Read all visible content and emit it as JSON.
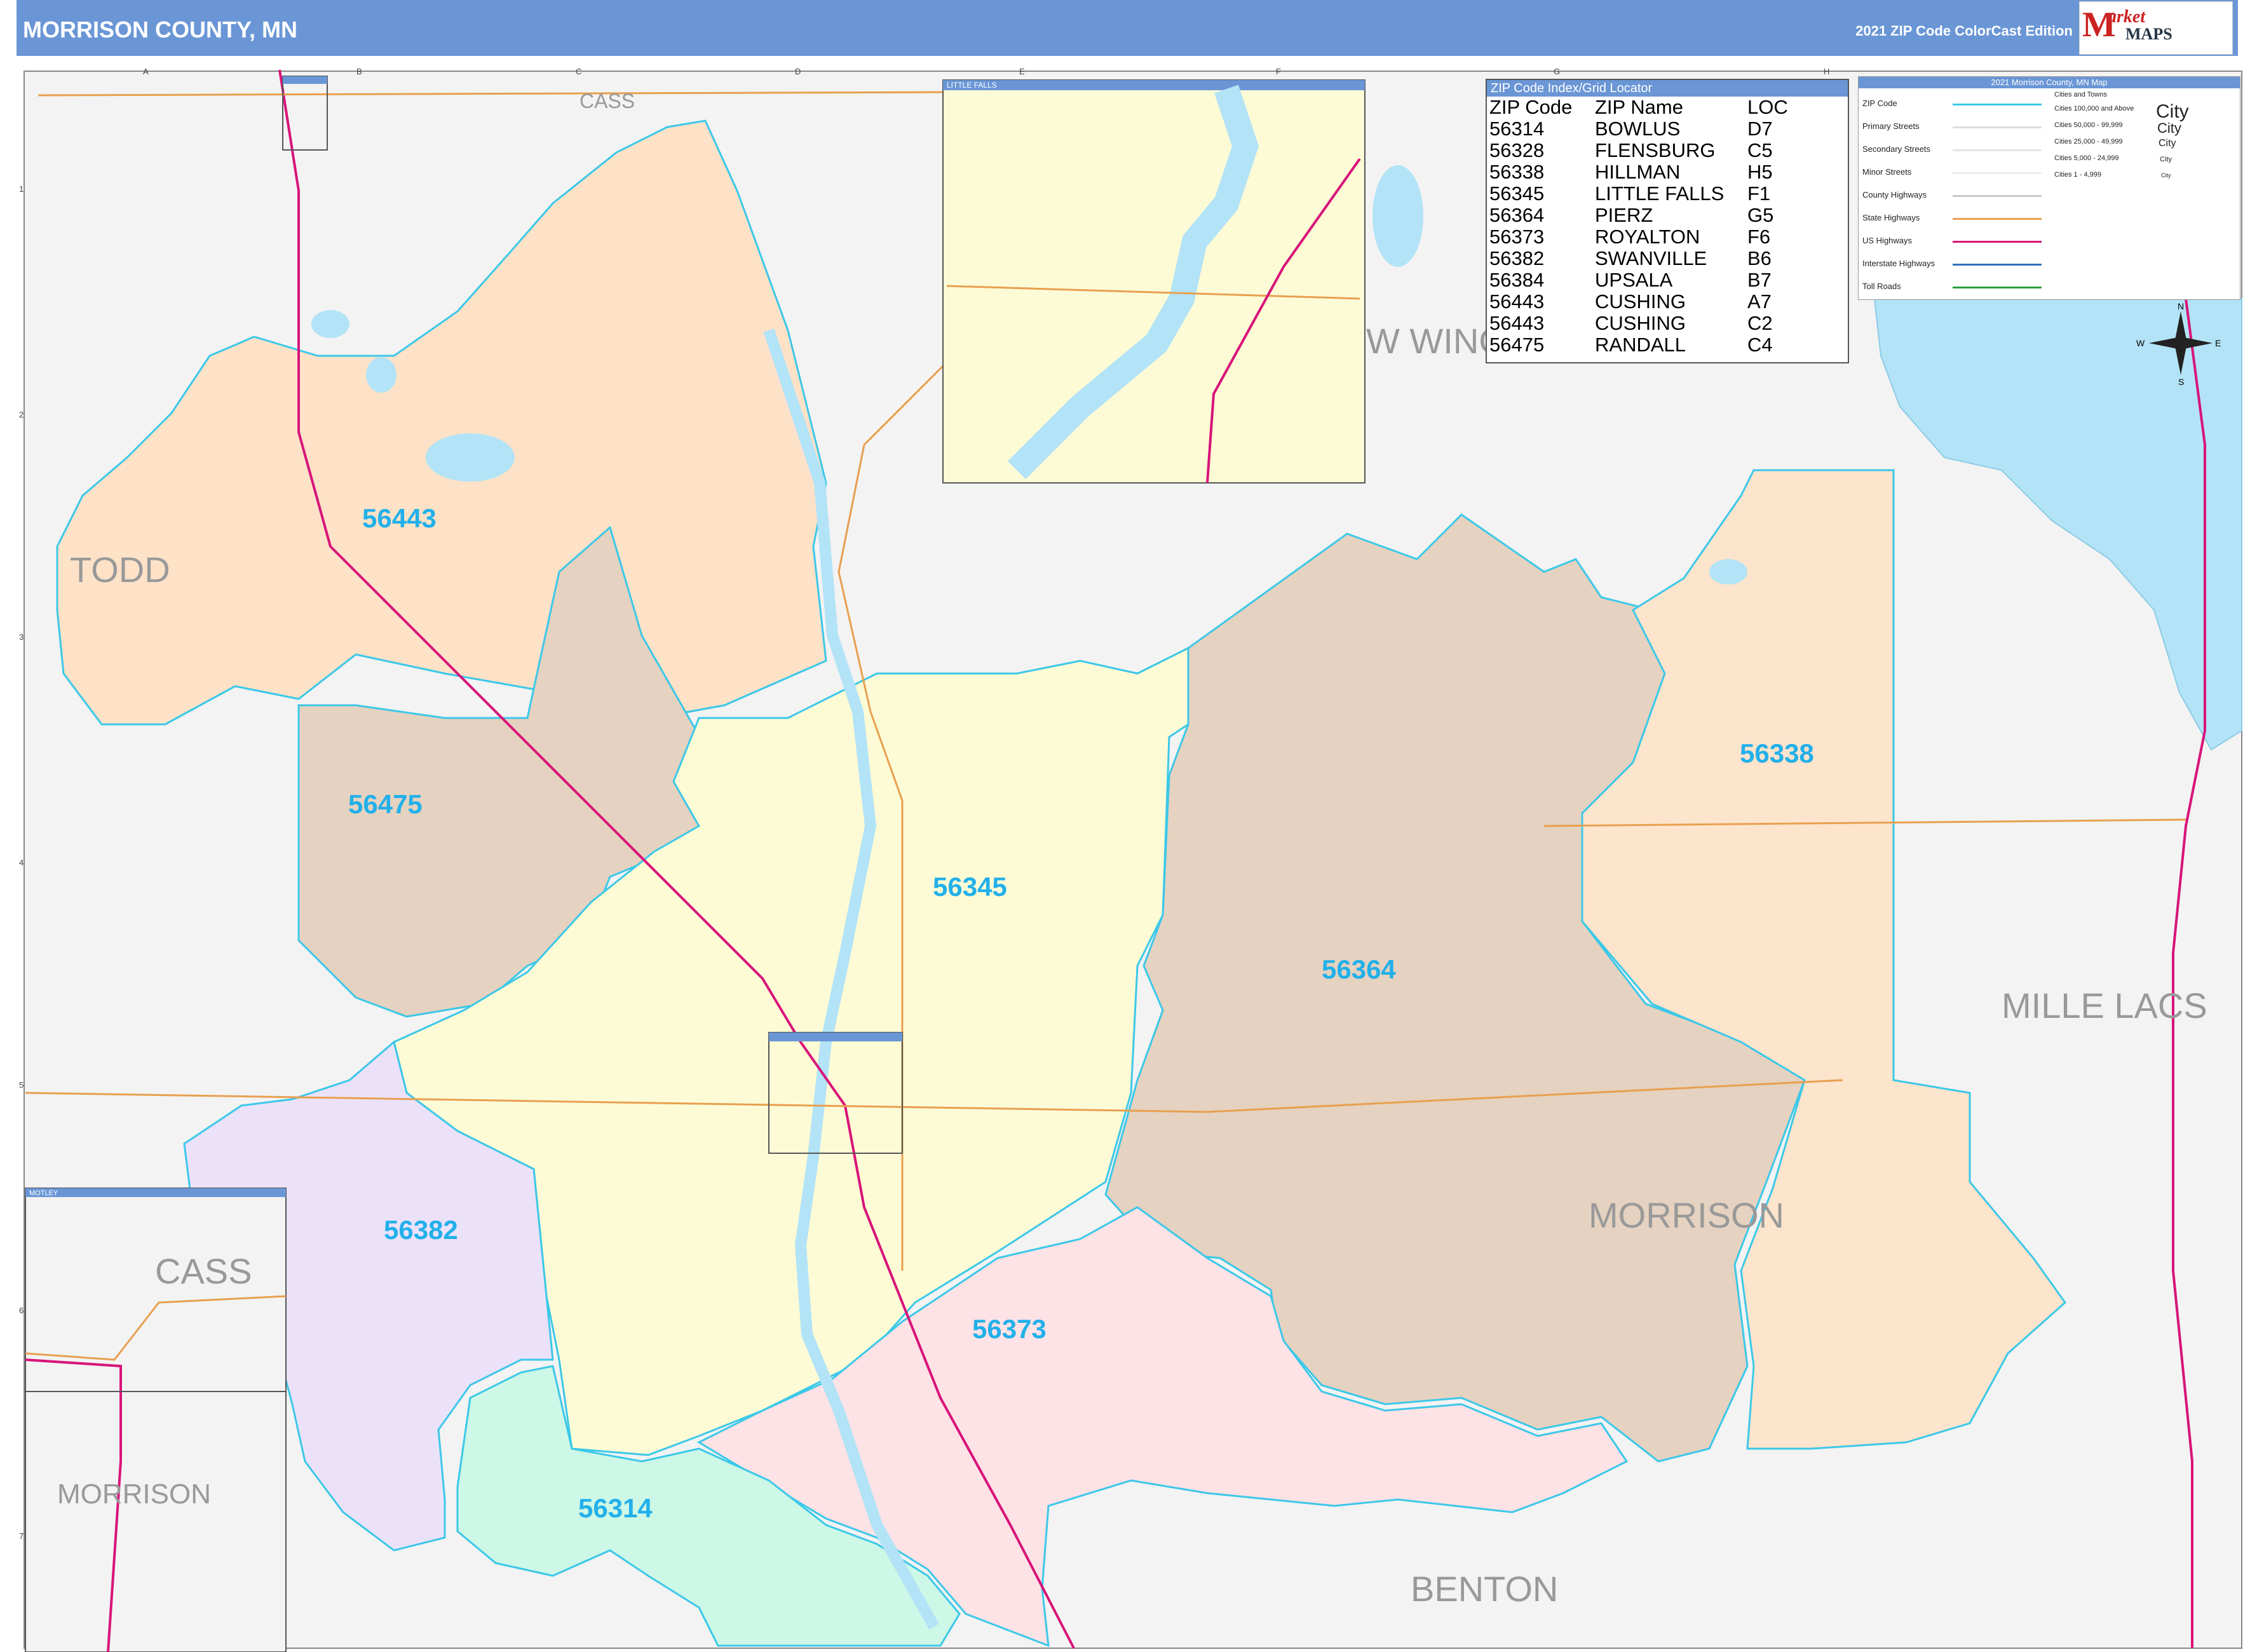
{
  "header": {
    "title": "MORRISON COUNTY, MN",
    "edition": "2021 ZIP Code ColorCast Edition",
    "logo_word": "arket",
    "logo_maps": "MAPS",
    "logo_m": "M"
  },
  "neighbor_labels": {
    "cass_top": "CASS",
    "todd": "TODD",
    "crow_wing": "W WING",
    "mille_lacs": "MILLE LACS",
    "benton": "BENTON",
    "morrison": "MORRISON"
  },
  "zip_labels": [
    "56443",
    "56475",
    "56345",
    "56364",
    "56338",
    "56382",
    "56373",
    "56314"
  ],
  "zip_index": {
    "header": "ZIP Code Index/Grid Locator",
    "columns": [
      "ZIP Code",
      "ZIP Name",
      "LOC"
    ],
    "rows": [
      [
        "56314",
        "BOWLUS",
        "D7"
      ],
      [
        "56328",
        "FLENSBURG",
        "C5"
      ],
      [
        "56338",
        "HILLMAN",
        "H5"
      ],
      [
        "56345",
        "LITTLE FALLS",
        "F1"
      ],
      [
        "56364",
        "PIERZ",
        "G5"
      ],
      [
        "56373",
        "ROYALTON",
        "F6"
      ],
      [
        "56382",
        "SWANVILLE",
        "B6"
      ],
      [
        "56384",
        "UPSALA",
        "B7"
      ],
      [
        "56443",
        "CUSHING",
        "A7"
      ],
      [
        "56443",
        "CUSHING",
        "C2"
      ],
      [
        "56475",
        "RANDALL",
        "C4"
      ]
    ]
  },
  "legend": {
    "header": "2021 Morrison County, MN Map",
    "items": [
      "ZIP Code",
      "Primary Streets",
      "Secondary Streets",
      "Minor Streets",
      "County Highways",
      "State Highways",
      "US Highways",
      "Interstate Highways",
      "Toll Roads"
    ],
    "cities_header": "Cities and Towns",
    "cities": [
      "Cities 100,000 and Above",
      "Cities 50,000 - 99,999",
      "Cities 25,000 - 49,999",
      "Cities 5,000 - 24,999",
      "Cities 1 - 4,999"
    ],
    "city_samples": [
      "City",
      "City",
      "City",
      "City",
      "City"
    ]
  },
  "inset_labels": {
    "little_falls": "LITTLE FALLS",
    "motley_small": "MOTLEY",
    "motley": "MOTLEY",
    "inset_cass": "CASS",
    "inset_morrison": "MORRISON"
  },
  "grid_letters": [
    "A",
    "B",
    "C",
    "D",
    "E",
    "F",
    "G",
    "H"
  ],
  "grid_numbers": [
    "1",
    "2",
    "3",
    "4",
    "5",
    "6",
    "7"
  ],
  "compass": {
    "n": "N",
    "s": "S",
    "e": "E",
    "w": "W"
  },
  "colors": {
    "header": "#6a96d6",
    "zip_label": "#22b0ea",
    "zip_border": "#3cc8e8",
    "water": "#b3e3f6",
    "us_highway": "#d8147a",
    "state_highway": "#e8a050",
    "zone_orange": "#fde2c8",
    "zone_brown": "#e5d2c0",
    "zone_yellow": "#fdfbd6",
    "zone_purple": "#ebe2fa",
    "zone_pink": "#fde2e6",
    "zone_green": "#cdf7e6",
    "zone_peach": "#fde4cc"
  }
}
